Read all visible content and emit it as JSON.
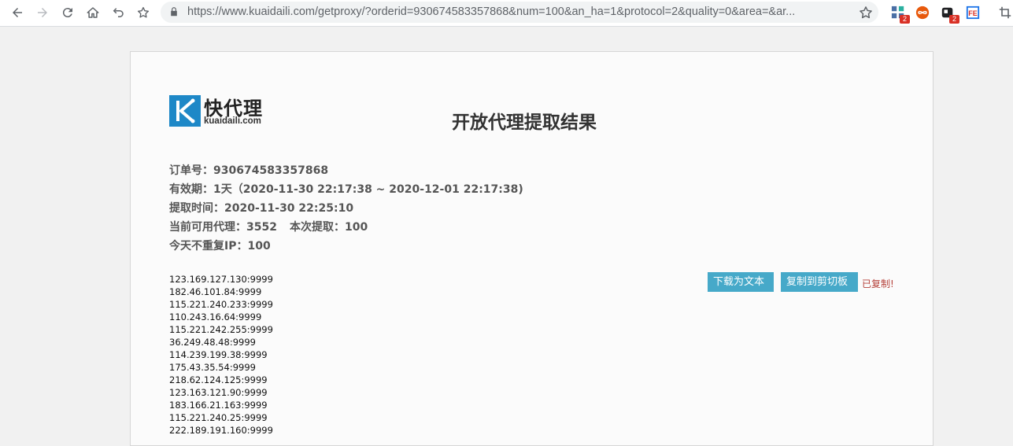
{
  "browser": {
    "url": "https://www.kuaidaili.com/getproxy/?orderid=930674583357868&num=100&an_ha=1&protocol=2&quality=0&area=&ar...",
    "extensions": [
      {
        "icon": "extension-grid-icon",
        "badge": "2"
      },
      {
        "icon": "infinity-extension-icon",
        "badge": ""
      },
      {
        "icon": "extension-dark-icon",
        "badge": "2"
      },
      {
        "icon": "fe-extension-icon",
        "badge": ""
      }
    ]
  },
  "logo": {
    "text": "快代理",
    "domain": "kuaidaili.com"
  },
  "page": {
    "title": "开放代理提取结果"
  },
  "info": {
    "order_label": "订单号：",
    "order_value": "930674583357868",
    "validity_label": "有效期：",
    "validity_value": "1天（2020-11-30 22:17:38 ~ 2020-12-01 22:17:38)",
    "extract_time_label": "提取时间：",
    "extract_time_value": "2020-11-30 22:25:10",
    "available_label": "当前可用代理：",
    "available_value": "3552",
    "this_extract_label": "本次提取：",
    "this_extract_value": "100",
    "unique_ip_label": "今天不重复IP：",
    "unique_ip_value": "100"
  },
  "actions": {
    "download_label": "下载为文本",
    "copy_label": "复制到剪切板",
    "copied_status": "已复制!"
  },
  "proxies": [
    "123.169.127.130:9999",
    "182.46.101.84:9999",
    "115.221.240.233:9999",
    "110.243.16.64:9999",
    "115.221.242.255:9999",
    "36.249.48.48:9999",
    "114.239.199.38:9999",
    "175.43.35.54:9999",
    "218.62.124.125:9999",
    "123.163.121.90:9999",
    "183.166.21.163:9999",
    "115.221.240.25:9999",
    "222.189.191.160:9999"
  ]
}
